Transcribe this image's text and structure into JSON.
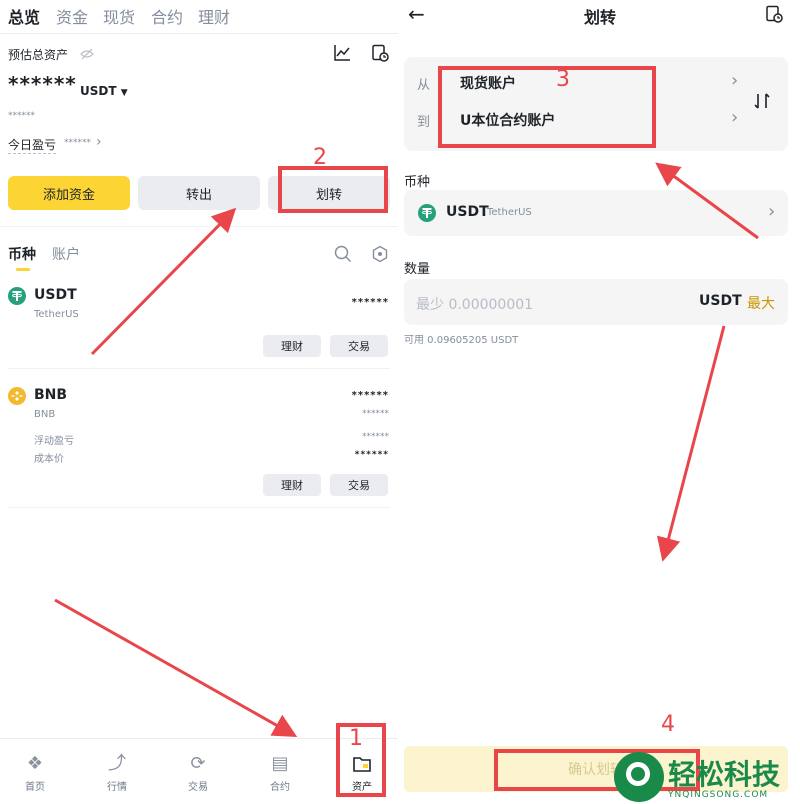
{
  "left": {
    "top_tabs": [
      "总览",
      "资金",
      "现货",
      "合约",
      "理财"
    ],
    "estimated_total_label": "预估总资产",
    "balance_masked": "******",
    "currency_select": "USDT",
    "sub_masked": "******",
    "today_pnl_label": "今日盈亏",
    "today_pnl_masked": "******",
    "buttons": {
      "add_funds": "添加资金",
      "transfer_out": "转出",
      "transfer": "划转"
    },
    "list_tabs": [
      "币种",
      "账户"
    ],
    "assets": [
      {
        "symbol": "USDT",
        "name": "TetherUS",
        "amount": "******",
        "btn_earn": "理财",
        "btn_trade": "交易"
      },
      {
        "symbol": "BNB",
        "name": "BNB",
        "amount": "******",
        "value": "******",
        "float_pnl_label": "浮动盈亏",
        "float_pnl": "******",
        "cost_label": "成本价",
        "cost": "******",
        "btn_earn": "理财",
        "btn_trade": "交易"
      }
    ],
    "bottom_nav": [
      {
        "label": "首页",
        "icon": "home-diamond-icon"
      },
      {
        "label": "行情",
        "icon": "market-chart-icon"
      },
      {
        "label": "交易",
        "icon": "trade-swap-icon"
      },
      {
        "label": "合约",
        "icon": "contract-doc-icon"
      },
      {
        "label": "资产",
        "icon": "wallet-icon"
      }
    ]
  },
  "right": {
    "title": "划转",
    "from_label": "从",
    "from_value": "现货账户",
    "to_label": "到",
    "to_value": "U本位合约账户",
    "coin_label": "币种",
    "coin_symbol": "USDT",
    "coin_name": "TetherUS",
    "amount_label": "数量",
    "amount_placeholder": "最少 0.00000001",
    "amount_unit": "USDT",
    "max_label": "最大",
    "available": "可用 0.09605205 USDT",
    "confirm_label": "确认划转"
  },
  "annotations": {
    "step1": "1",
    "step2": "2",
    "step3": "3",
    "step4": "4"
  },
  "watermark": {
    "cn": "轻松科技",
    "en": "YNQINGSONG.COM"
  },
  "colors": {
    "accent": "#fcd535",
    "annotation_red": "#e8464b",
    "max_yellow": "#c99400",
    "usdt_green": "#26a17b",
    "bnb_yellow": "#f3ba2f"
  }
}
